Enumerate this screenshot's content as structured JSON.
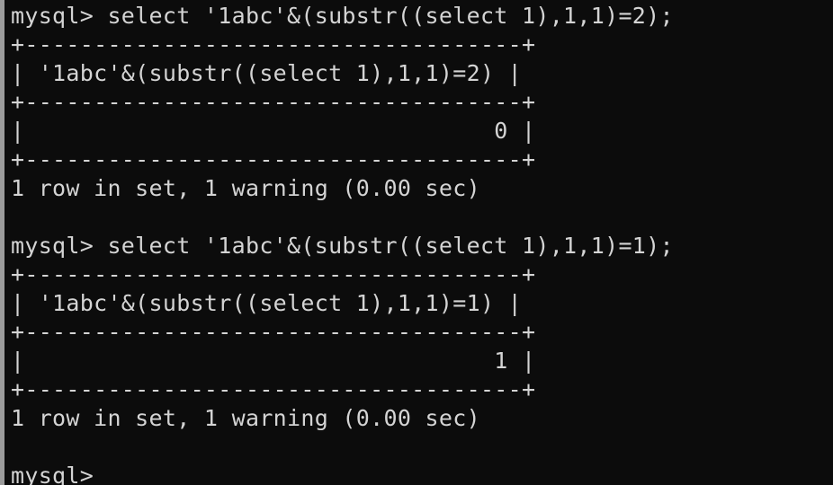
{
  "terminal": {
    "background": "#0c0c0c",
    "foreground": "#d4d4d4",
    "blocks": [
      {
        "command": "mysql> select '1abc'&(substr((select 1),1,1)=2);",
        "border_top": "+------------------------------------+",
        "header": "| '1abc'&(substr((select 1),1,1)=2) |",
        "border_mid": "+------------------------------------+",
        "row": "|                                  0 |",
        "border_bottom": "+------------------------------------+",
        "result": "1 row in set, 1 warning (0.00 sec)"
      },
      {
        "command": "mysql> select '1abc'&(substr((select 1),1,1)=1);",
        "border_top": "+------------------------------------+",
        "header": "| '1abc'&(substr((select 1),1,1)=1) |",
        "border_mid": "+------------------------------------+",
        "row": "|                                  1 |",
        "border_bottom": "+------------------------------------+",
        "result": "1 row in set, 1 warning (0.00 sec)"
      }
    ],
    "prompt": "mysql>"
  }
}
